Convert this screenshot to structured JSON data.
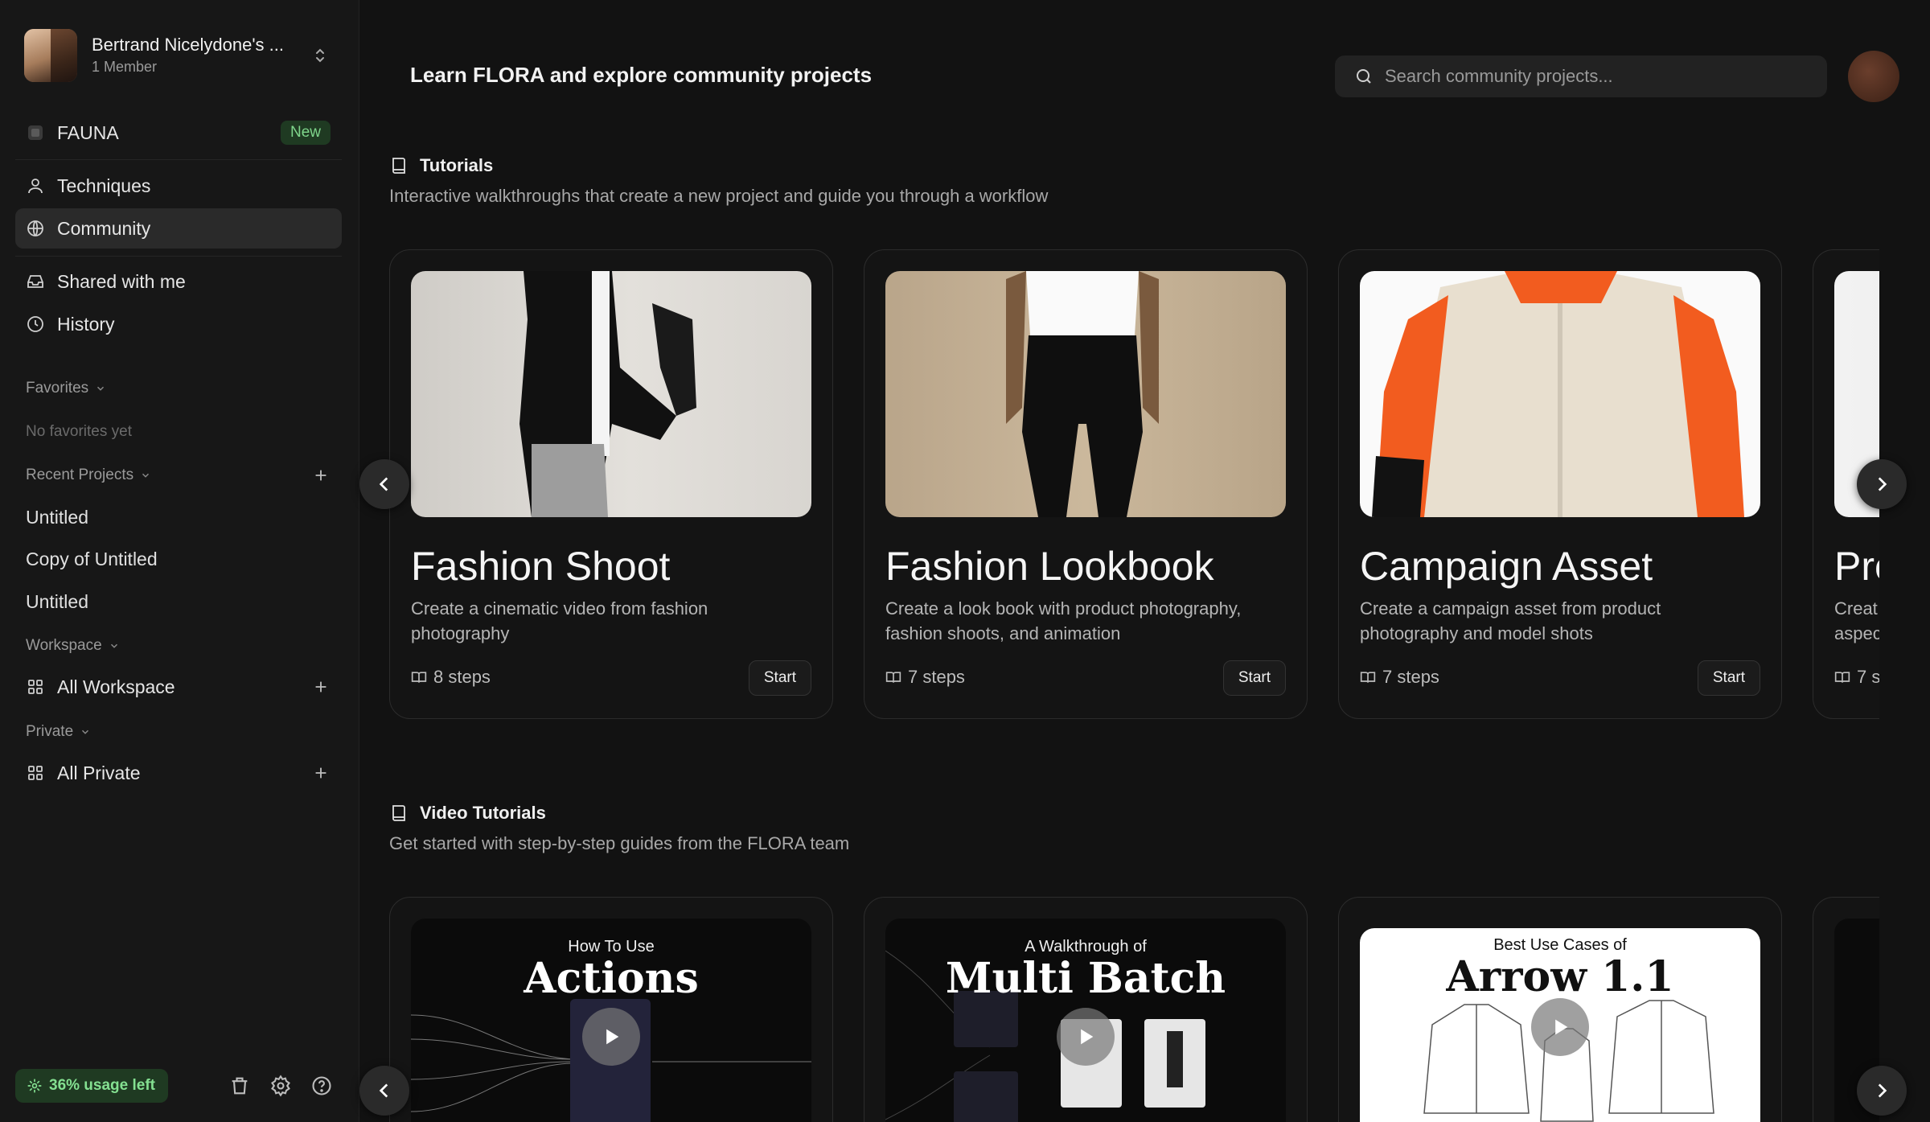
{
  "workspace": {
    "name": "Bertrand Nicelydone's ...",
    "members": "1 Member"
  },
  "nav": {
    "fauna": "FAUNA",
    "fauna_badge": "New",
    "techniques": "Techniques",
    "community": "Community",
    "shared": "Shared with me",
    "history": "History"
  },
  "favorites": {
    "header": "Favorites",
    "empty": "No favorites yet"
  },
  "recent": {
    "header": "Recent Projects",
    "items": [
      "Untitled",
      "Copy of Untitled",
      "Untitled"
    ]
  },
  "workspace_section": {
    "header": "Workspace",
    "item": "All Workspace"
  },
  "private_section": {
    "header": "Private",
    "item": "All Private"
  },
  "usage": "36% usage left",
  "header": {
    "title": "Learn FLORA and explore community projects",
    "search_placeholder": "Search community projects..."
  },
  "tutorials": {
    "title": "Tutorials",
    "description": "Interactive walkthroughs that create a new project and guide you through a workflow",
    "cards": [
      {
        "title": "Fashion Shoot",
        "description": "Create a cinematic video from fashion photography",
        "steps": "8 steps",
        "action": "Start"
      },
      {
        "title": "Fashion Lookbook",
        "description": "Create a look book with product photography, fashion shoots, and animation",
        "steps": "7 steps",
        "action": "Start"
      },
      {
        "title": "Campaign Asset",
        "description": "Create a campaign asset from product photography and model shots",
        "steps": "7 steps",
        "action": "Start"
      },
      {
        "title": "Pre",
        "description": "Creat aspec",
        "steps": "7 s",
        "action": ""
      }
    ]
  },
  "video_tutorials": {
    "title": "Video Tutorials",
    "description": "Get started with step-by-step guides from the FLORA team",
    "videos": [
      {
        "caption_small": "How To Use",
        "caption_big": "Actions"
      },
      {
        "caption_small": "A Walkthrough of",
        "caption_big": "Multi Batch"
      },
      {
        "caption_small": "Best Use Cases of",
        "caption_big": "Arrow 1.1"
      }
    ]
  }
}
